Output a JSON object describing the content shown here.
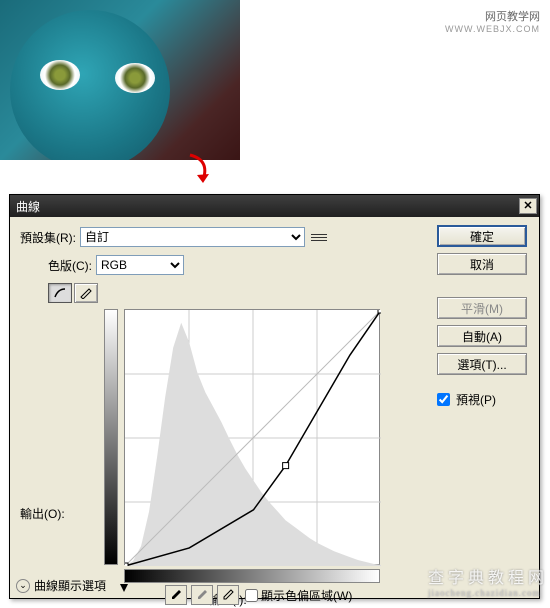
{
  "watermark_top": {
    "line1": "网页教学网",
    "line2": "WWW.WEBJX.COM"
  },
  "watermark_bottom": {
    "line1": "查字典教程网",
    "line2": "jiaocheng.chazidian.com"
  },
  "dialog": {
    "title": "曲線",
    "preset_label": "預設集(R):",
    "preset_value": "自訂",
    "channel_label": "色版(C):",
    "channel_value": "RGB",
    "output_label": "輸出(O):",
    "input_label": "輸入(I):",
    "clip_label": "顯示色偏區域(W)",
    "expand_label": "曲線顯示選項",
    "buttons": {
      "ok": "確定",
      "cancel": "取消",
      "smooth": "平滑(M)",
      "auto": "自動(A)",
      "options": "選項(T)..."
    },
    "preview_label": "預視(P)",
    "preview_checked": true
  },
  "chart_data": {
    "type": "line",
    "title": "",
    "xlabel": "輸入",
    "ylabel": "輸出",
    "xlim": [
      0,
      255
    ],
    "ylim": [
      0,
      255
    ],
    "series": [
      {
        "name": "diagonal",
        "x": [
          0,
          255
        ],
        "y": [
          0,
          255
        ]
      },
      {
        "name": "curve",
        "x": [
          0,
          64,
          128,
          160,
          192,
          224,
          255
        ],
        "y": [
          0,
          18,
          56,
          100,
          155,
          210,
          255
        ]
      }
    ],
    "histogram": {
      "x": [
        0,
        8,
        16,
        24,
        32,
        40,
        48,
        56,
        64,
        72,
        80,
        88,
        96,
        104,
        112,
        120,
        128,
        136,
        144,
        152,
        160,
        168,
        176,
        184,
        192,
        200,
        208,
        216,
        224,
        232,
        240,
        248,
        255
      ],
      "y": [
        0,
        5,
        20,
        55,
        110,
        170,
        220,
        245,
        225,
        195,
        175,
        160,
        145,
        128,
        112,
        98,
        86,
        74,
        64,
        55,
        46,
        40,
        34,
        28,
        23,
        19,
        15,
        12,
        9,
        6,
        4,
        2,
        1
      ]
    },
    "control_points": [
      {
        "x": 0,
        "y": 0
      },
      {
        "x": 160,
        "y": 100
      },
      {
        "x": 255,
        "y": 255
      }
    ]
  }
}
